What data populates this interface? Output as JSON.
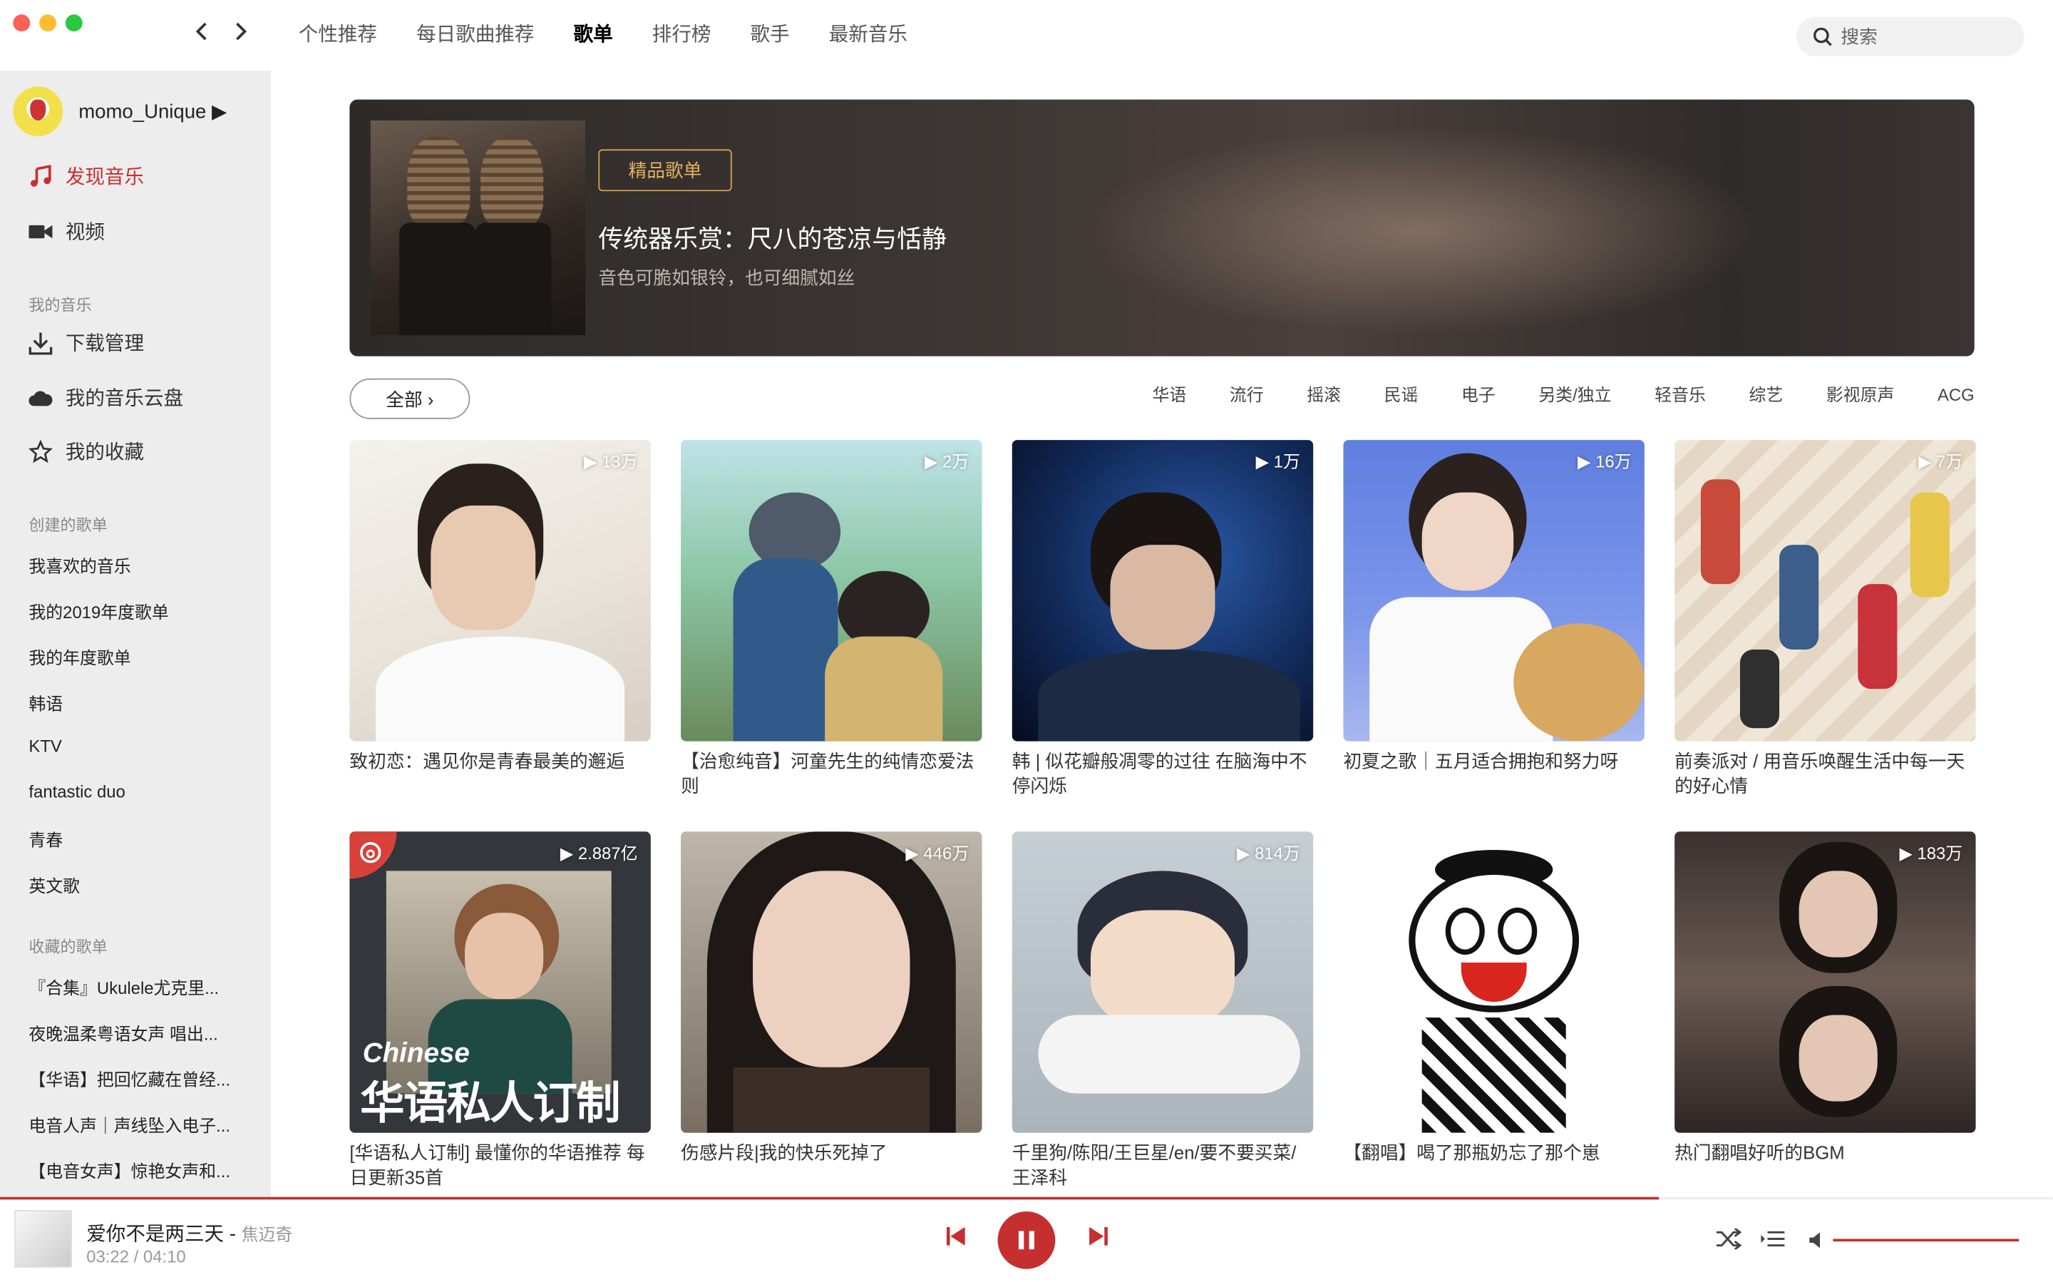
{
  "nav": {
    "back_label": "‹",
    "forward_label": "›",
    "tabs": [
      {
        "label": "个性推荐"
      },
      {
        "label": "每日歌曲推荐"
      },
      {
        "label": "歌单",
        "active": true
      },
      {
        "label": "排行榜"
      },
      {
        "label": "歌手"
      },
      {
        "label": "最新音乐"
      }
    ],
    "search_placeholder": "搜索"
  },
  "sidebar": {
    "username": "momo_Unique ▶",
    "main_items": [
      {
        "label": "发现音乐",
        "icon": "music-note-icon",
        "active": true
      },
      {
        "label": "视频",
        "icon": "video-camera-icon"
      }
    ],
    "my_music_title": "我的音乐",
    "my_music": [
      {
        "label": "下载管理",
        "icon": "download-icon"
      },
      {
        "label": "我的音乐云盘",
        "icon": "cloud-icon"
      },
      {
        "label": "我的收藏",
        "icon": "star-icon"
      }
    ],
    "created_title": "创建的歌单",
    "created": [
      "我喜欢的音乐",
      "我的2019年度歌单",
      "我的年度歌单",
      "韩语",
      "KTV",
      "fantastic duo",
      "青春",
      "英文歌"
    ],
    "collected_title": "收藏的歌单",
    "collected": [
      "『合集』Ukulele尤克里...",
      "夜晚温柔粤语女声 唱出...",
      "【华语】把回忆藏在曾经...",
      "电音人声｜声线坠入电子...",
      "【电音女声】惊艳女声和..."
    ]
  },
  "banner": {
    "badge": "精品歌单",
    "title": "传统器乐赏：尺八的苍凉与恬静",
    "subtitle": "音色可脆如银铃，也可细腻如丝"
  },
  "filter": {
    "all_label": "全部 ›",
    "categories": [
      "华语",
      "流行",
      "摇滚",
      "民谣",
      "电子",
      "另类/独立",
      "轻音乐",
      "综艺",
      "影视原声",
      "ACG"
    ]
  },
  "playlists": [
    {
      "title": "致初恋：遇见你是青春最美的邂逅",
      "count": "▶ 13万"
    },
    {
      "title": "【治愈纯音】河童先生的纯情恋爱法则",
      "count": "▶ 2万"
    },
    {
      "title": "韩 | 似花瓣般凋零的过往 在脑海中不停闪烁",
      "count": "▶ 1万"
    },
    {
      "title": "初夏之歌｜五月适合拥抱和努力呀",
      "count": "▶ 16万"
    },
    {
      "title": "前奏派对 / 用音乐唤醒生活中每一天的好心情",
      "count": "▶ 7万"
    },
    {
      "title": "[华语私人订制] 最懂你的华语推荐 每日更新35首",
      "count": "▶ 2.887亿",
      "cover_en": "Chinese",
      "cover_cn": "华语私人订制"
    },
    {
      "title": "伤感片段|我的快乐死掉了",
      "count": "▶ 446万"
    },
    {
      "title": "千里狗/陈阳/王巨星/en/要不要买菜/王泽科",
      "count": "▶ 814万"
    },
    {
      "title": "【翻唱】喝了那瓶奶忘了那个崽",
      "count": ""
    },
    {
      "title": "热门翻唱好听的BGM",
      "count": "▶ 183万"
    }
  ],
  "player": {
    "song": "爱你不是两三天 - ",
    "artist": "焦迈奇",
    "time": "03:22 / 04:10",
    "progress": 0.808,
    "volume": 1.0,
    "accent": "#c62f2f"
  }
}
